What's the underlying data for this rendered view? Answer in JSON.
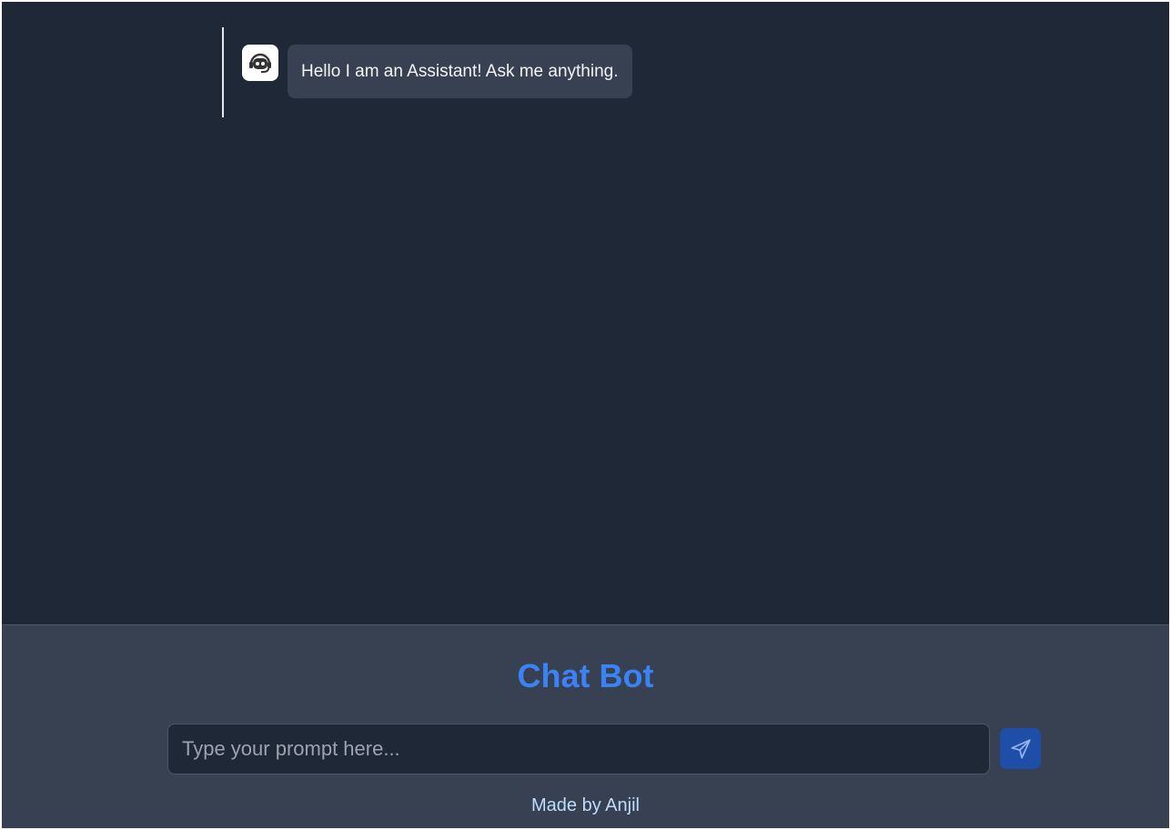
{
  "chat": {
    "messages": [
      {
        "role": "assistant",
        "avatar_icon": "robot-icon",
        "text": "Hello I am an Assistant! Ask me anything."
      }
    ]
  },
  "footer": {
    "title": "Chat Bot",
    "input_placeholder": "Type your prompt here...",
    "input_value": "",
    "send_icon": "send-icon",
    "credit": "Made by Anjil"
  },
  "colors": {
    "background": "#1f2837",
    "footer_background": "#374151",
    "accent": "#3b82f6",
    "send_button": "#1e4ea8",
    "bubble": "#374151",
    "credit_text": "#bfdbfe"
  }
}
